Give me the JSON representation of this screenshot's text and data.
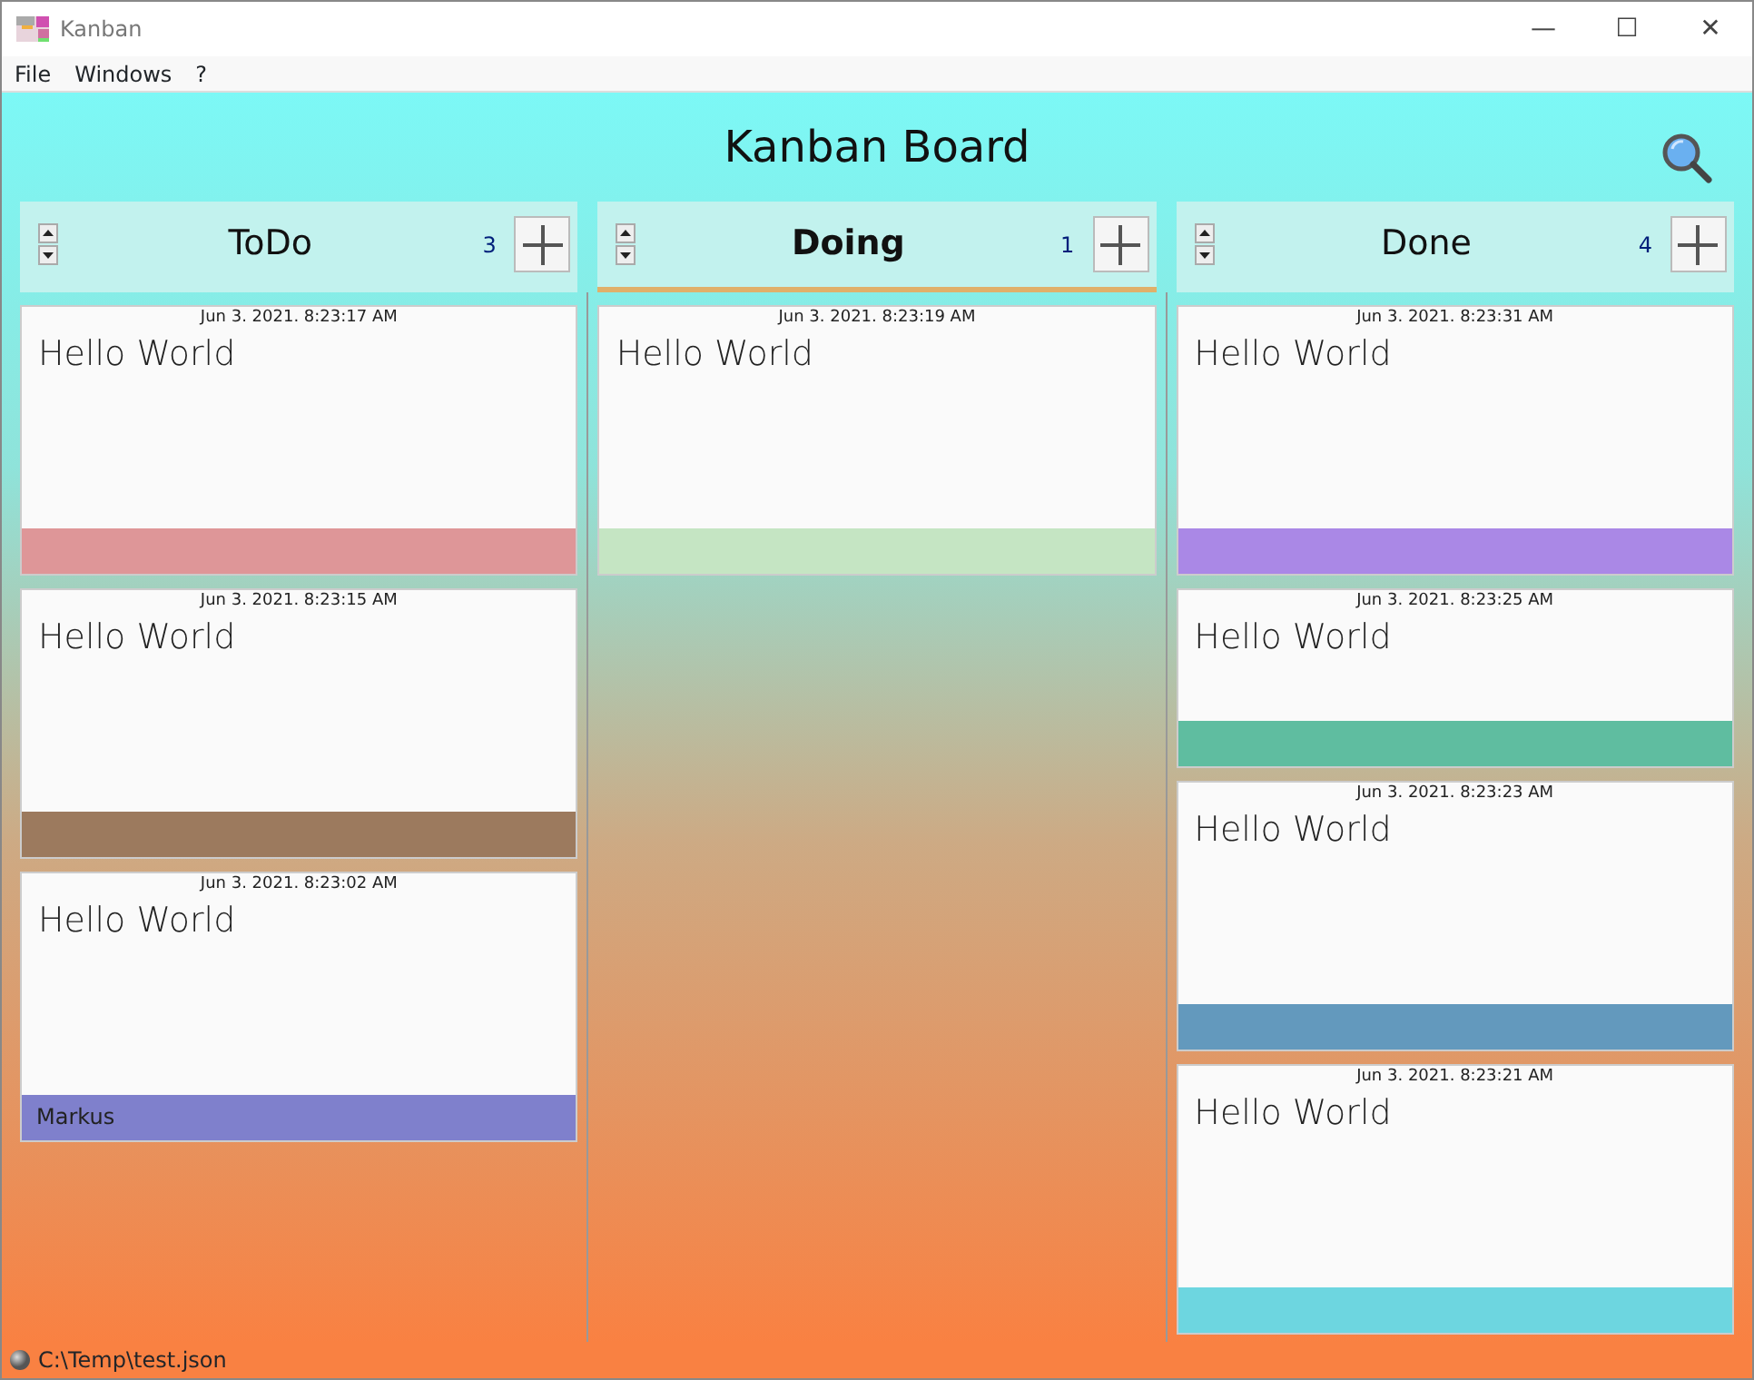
{
  "window": {
    "title": "Kanban",
    "controls": [
      "—",
      "☐",
      "✕"
    ]
  },
  "menu": [
    "File",
    "Windows",
    "?"
  ],
  "board": {
    "title": "Kanban Board",
    "columns": [
      {
        "name": "ToDo",
        "count": "3",
        "selected": false,
        "cards": [
          {
            "date": "Jun 3. 2021. 8:23:17 AM",
            "text": "Hello World",
            "color": "#de9698",
            "kind": "large"
          },
          {
            "date": "Jun 3. 2021. 8:23:15 AM",
            "text": "Hello World",
            "color": "#9c7a5e",
            "kind": "large"
          },
          {
            "date": "Jun 3. 2021. 8:23:02 AM",
            "text": "Hello World",
            "color": "#7f80cc",
            "kind": "large",
            "footer": "Markus"
          }
        ]
      },
      {
        "name": "Doing",
        "count": "1",
        "selected": true,
        "cards": [
          {
            "date": "Jun 3. 2021. 8:23:19 AM",
            "text": "Hello World",
            "color": "#c5e5c3",
            "kind": "large"
          }
        ]
      },
      {
        "name": "Done",
        "count": "4",
        "selected": false,
        "cards": [
          {
            "date": "Jun 3. 2021. 8:23:31 AM",
            "text": "Hello World",
            "color": "#aa88e6",
            "kind": "large"
          },
          {
            "date": "Jun 3. 2021. 8:23:25 AM",
            "text": "Hello World",
            "color": "#5fbda0",
            "kind": "small"
          },
          {
            "date": "Jun 3. 2021. 8:23:23 AM",
            "text": "Hello World",
            "color": "#6399bd",
            "kind": "large"
          },
          {
            "date": "Jun 3. 2021. 8:23:21 AM",
            "text": "Hello World",
            "color": "#6dd6e0",
            "kind": "large"
          }
        ]
      }
    ]
  },
  "status_bar": {
    "path": "C:\\Temp\\test.json"
  }
}
